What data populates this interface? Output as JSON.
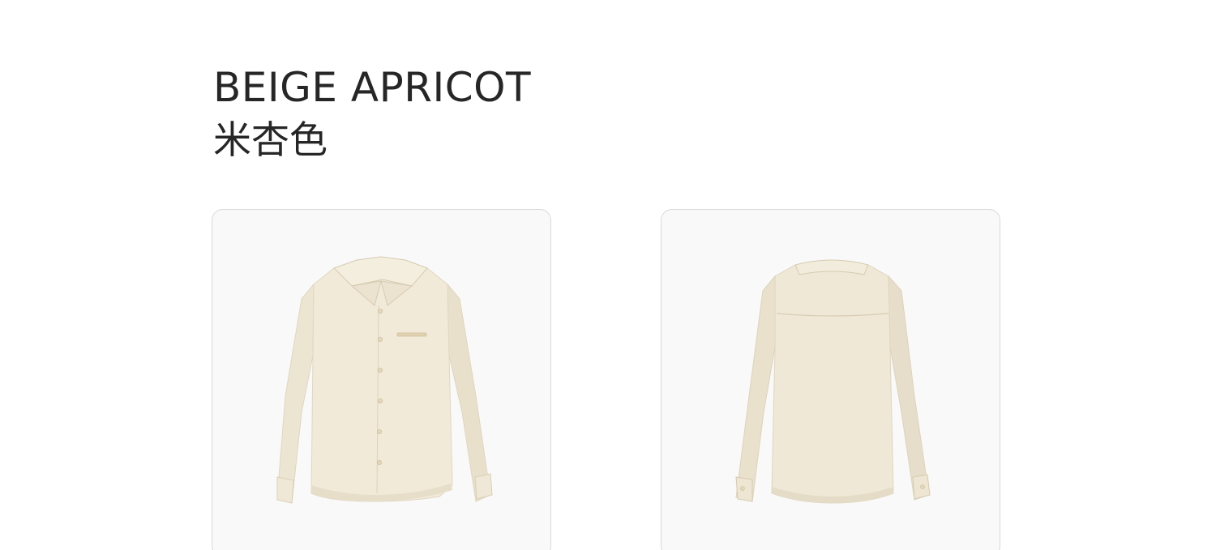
{
  "product": {
    "color_name_en": "BEIGE APRICOT",
    "color_name_cn": "米杏色",
    "images": [
      {
        "view": "front",
        "icon": "shirt-front-image"
      },
      {
        "view": "back",
        "icon": "shirt-back-image"
      }
    ]
  },
  "colors": {
    "fabric": "#efe8d6",
    "fabric_shadow": "#e2d9c2",
    "seam": "#d2c6a9",
    "card_bg": "#f9f9f9",
    "card_border": "#d9d9d9",
    "text": "#262626"
  }
}
